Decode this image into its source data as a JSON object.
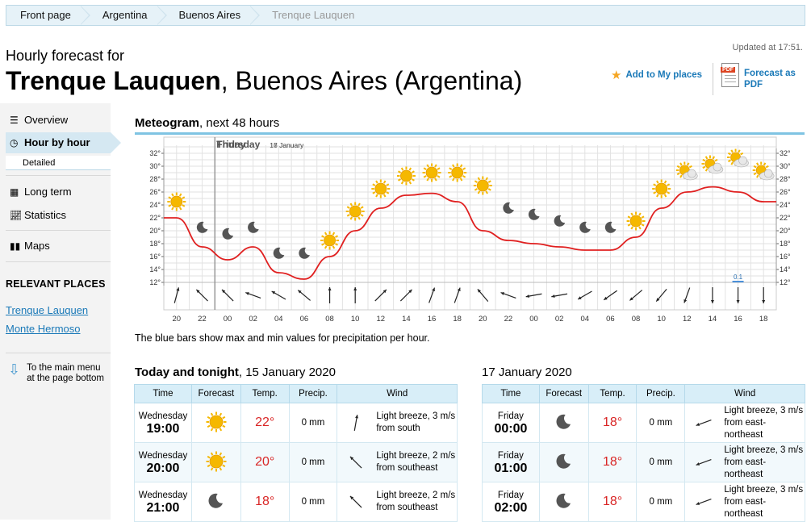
{
  "breadcrumb": [
    "Front page",
    "Argentina",
    "Buenos Aires",
    "Trenque Lauquen"
  ],
  "header": {
    "updated": "Updated at 17:51.",
    "subtitle": "Hourly forecast for",
    "title_bold": "Trenque Lauquen",
    "title_rest": ", Buenos Aires (Argentina)",
    "add_places": "Add to My places",
    "pdf_line1": "Forecast as",
    "pdf_line2": "PDF",
    "pdf_badge": "PDF"
  },
  "sidebar": {
    "overview": "Overview",
    "hour_by_hour": "Hour by hour",
    "detailed": "Detailed",
    "long_term": "Long term",
    "statistics": "Statistics",
    "maps": "Maps",
    "relevant_title": "RELEVANT PLACES",
    "relevant": [
      "Trenque Lauquen",
      "Monte Hermoso"
    ],
    "to_menu_1": "To the main menu",
    "to_menu_2": "at the page bottom"
  },
  "meteogram": {
    "title_bold": "Meteogram",
    "title_rest": ", next 48 hours",
    "note": "The blue bars show max and min values for precipitation per hour."
  },
  "chart_data": {
    "type": "line",
    "days": [
      {
        "name": "Thursday",
        "date": "16 January",
        "at_hour": "00"
      },
      {
        "name": "Friday",
        "date": "17 January",
        "at_hour": "00"
      }
    ],
    "x": [
      "20",
      "22",
      "00",
      "02",
      "04",
      "06",
      "08",
      "10",
      "12",
      "14",
      "16",
      "18",
      "20",
      "22",
      "00",
      "02",
      "04",
      "06",
      "08",
      "10",
      "12",
      "14",
      "16",
      "18"
    ],
    "y_ticks": [
      "12°",
      "14°",
      "16°",
      "18°",
      "20°",
      "22°",
      "24°",
      "26°",
      "28°",
      "30°",
      "32°"
    ],
    "ylim": [
      12,
      33
    ],
    "temperature": [
      22,
      17.5,
      15.5,
      17.5,
      13.5,
      12.5,
      16,
      20,
      23.5,
      25.5,
      25.8,
      24.5,
      20,
      18.5,
      18,
      17.5,
      17,
      17,
      19,
      23.5,
      26,
      26.8,
      26,
      24.5
    ],
    "icons": [
      "sun",
      "moon",
      "moon",
      "moon",
      "moon",
      "moon",
      "sun",
      "sun",
      "sun",
      "sun",
      "sun",
      "sun",
      "sun",
      "moon",
      "moon",
      "moon",
      "moon",
      "moon",
      "sun",
      "sun",
      "sun-cloud",
      "sun-cloud",
      "sun-cloud",
      "sun-cloud"
    ],
    "icon_temps": [
      24.5,
      20.5,
      19.5,
      20.5,
      16.5,
      16.5,
      18.5,
      23,
      26.5,
      28.5,
      29,
      29,
      27,
      23.5,
      22.5,
      21.5,
      20.5,
      20.5,
      21.5,
      26.5,
      29,
      30,
      31,
      29
    ],
    "wind_dir_deg": [
      195,
      135,
      135,
      110,
      120,
      130,
      180,
      180,
      225,
      225,
      200,
      200,
      140,
      110,
      80,
      80,
      60,
      55,
      50,
      40,
      20,
      0,
      0,
      0
    ],
    "precip": [
      {
        "at_hour": "16",
        "day": "Friday",
        "value": "0.1"
      }
    ],
    "grid": true
  },
  "today": {
    "title_bold": "Today and tonight",
    "title_rest": ", 15 January 2020",
    "columns": [
      "Time",
      "Forecast",
      "Temp.",
      "Precip.",
      "Wind"
    ],
    "rows": [
      {
        "day": "Wednesday",
        "time": "19:00",
        "icon": "sun",
        "temp": "22°",
        "precip": "0 mm",
        "wind1": "Light breeze, 3 m/s",
        "wind2": "from south",
        "dir": 190
      },
      {
        "day": "Wednesday",
        "time": "20:00",
        "icon": "sun",
        "temp": "20°",
        "precip": "0 mm",
        "wind1": "Light breeze, 2 m/s",
        "wind2": "from southeast",
        "dir": 135
      },
      {
        "day": "Wednesday",
        "time": "21:00",
        "icon": "moon",
        "temp": "18°",
        "precip": "0 mm",
        "wind1": "Light breeze, 2 m/s",
        "wind2": "from southeast",
        "dir": 135
      }
    ]
  },
  "tomorrow": {
    "title": "17 January 2020",
    "columns": [
      "Time",
      "Forecast",
      "Temp.",
      "Precip.",
      "Wind"
    ],
    "rows": [
      {
        "day": "Friday",
        "time": "00:00",
        "icon": "moon",
        "temp": "18°",
        "precip": "0 mm",
        "wind1": "Light breeze, 3 m/s",
        "wind2": "from east-northeast",
        "dir": 70
      },
      {
        "day": "Friday",
        "time": "01:00",
        "icon": "moon",
        "temp": "18°",
        "precip": "0 mm",
        "wind1": "Light breeze, 3 m/s",
        "wind2": "from east-northeast",
        "dir": 70
      },
      {
        "day": "Friday",
        "time": "02:00",
        "icon": "moon",
        "temp": "18°",
        "precip": "0 mm",
        "wind1": "Light breeze, 3 m/s",
        "wind2": "from east-northeast",
        "dir": 70
      }
    ]
  },
  "colors": {
    "accent": "#1a79b8",
    "temp_line": "#e02020",
    "temp_text": "#d92626",
    "header_bg": "#d8eef8",
    "sun": "#f5b800",
    "moon": "#555555"
  }
}
